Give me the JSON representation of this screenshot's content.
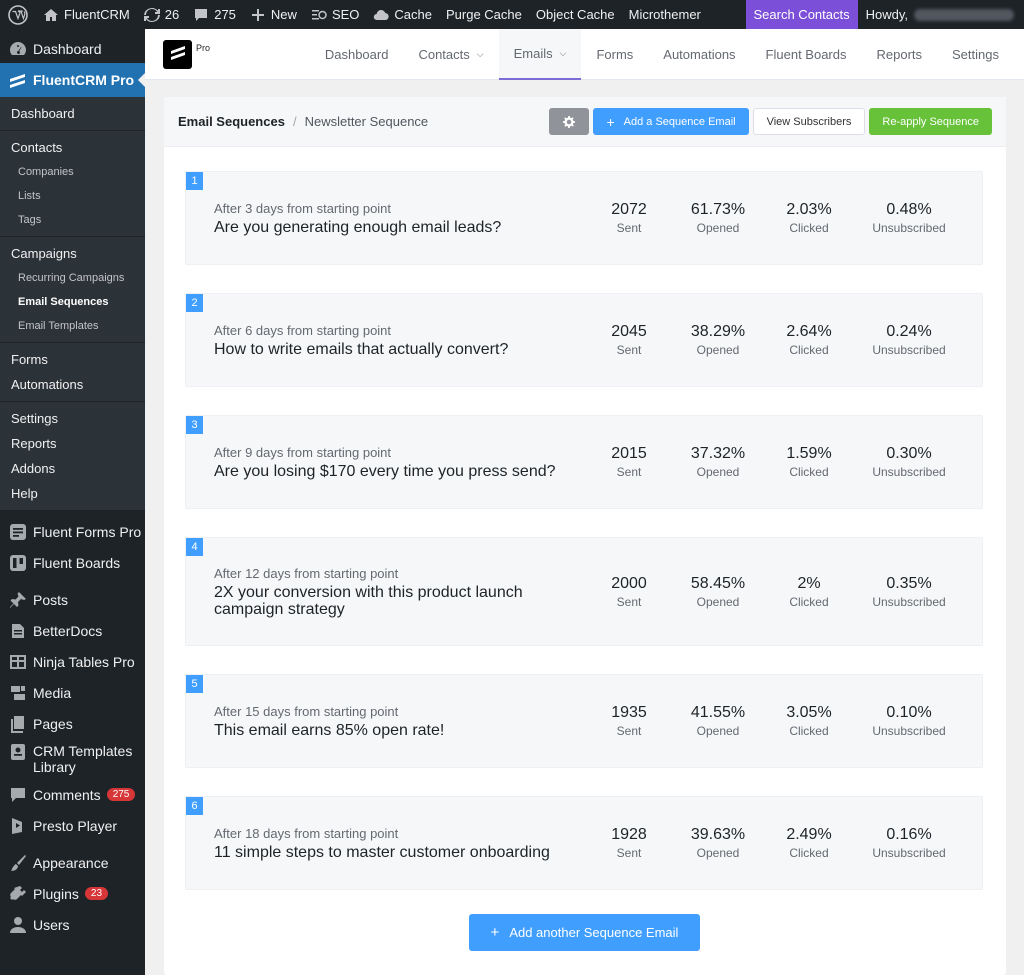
{
  "adminbar": {
    "site_name": "FluentCRM",
    "updates_count": "26",
    "comments_count": "275",
    "new_label": "New",
    "seo_label": "SEO",
    "cache_label": "Cache",
    "purge_cache_label": "Purge Cache",
    "object_cache_label": "Object Cache",
    "microthemer_label": "Microthemer",
    "search_contacts_label": "Search Contacts",
    "howdy_label": "Howdy,"
  },
  "sidebar": {
    "dashboard": "Dashboard",
    "fluentcrm_pro": "FluentCRM Pro",
    "sub": {
      "dashboard": "Dashboard",
      "contacts": "Contacts",
      "companies": "Companies",
      "lists": "Lists",
      "tags": "Tags",
      "campaigns": "Campaigns",
      "recurring": "Recurring Campaigns",
      "sequences": "Email Sequences",
      "templates": "Email Templates",
      "forms": "Forms",
      "automations": "Automations",
      "settings": "Settings",
      "reports": "Reports",
      "addons": "Addons",
      "help": "Help"
    },
    "fluent_forms": "Fluent Forms Pro",
    "fluent_boards": "Fluent Boards",
    "posts": "Posts",
    "betterdocs": "BetterDocs",
    "ninja_tables": "Ninja Tables Pro",
    "media": "Media",
    "pages": "Pages",
    "crm_templates_1": "CRM Templates",
    "crm_templates_2": "Library",
    "comments": "Comments",
    "comments_badge": "275",
    "presto": "Presto Player",
    "appearance": "Appearance",
    "plugins": "Plugins",
    "plugins_badge": "23",
    "users": "Users"
  },
  "topnav": {
    "logo_badge": "Pro",
    "links": [
      "Dashboard",
      "Contacts",
      "Emails",
      "Forms",
      "Automations",
      "Fluent Boards",
      "Reports",
      "Settings"
    ]
  },
  "header": {
    "breadcrumb_main": "Email Sequences",
    "breadcrumb_sep": "/",
    "breadcrumb_sub": "Newsletter Sequence",
    "add_email_label": "Add a Sequence Email",
    "view_subscribers_label": "View Subscribers",
    "reapply_label": "Re-apply Sequence"
  },
  "stat_labels": {
    "sent": "Sent",
    "opened": "Opened",
    "clicked": "Clicked",
    "unsubscribed": "Unsubscribed"
  },
  "sequences": [
    {
      "num": "1",
      "delay": "After 3 days from starting point",
      "title": "Are you generating enough email leads?",
      "sent": "2072",
      "opened": "61.73%",
      "clicked": "2.03%",
      "unsub": "0.48%"
    },
    {
      "num": "2",
      "delay": "After 6 days from starting point",
      "title": "How to write emails that actually convert?",
      "sent": "2045",
      "opened": "38.29%",
      "clicked": "2.64%",
      "unsub": "0.24%"
    },
    {
      "num": "3",
      "delay": "After 9 days from starting point",
      "title": "Are you losing $170 every time you press send?",
      "sent": "2015",
      "opened": "37.32%",
      "clicked": "1.59%",
      "unsub": "0.30%"
    },
    {
      "num": "4",
      "delay": "After 12 days from starting point",
      "title": "2X your conversion with this product launch campaign strategy",
      "sent": "2000",
      "opened": "58.45%",
      "clicked": "2%",
      "unsub": "0.35%"
    },
    {
      "num": "5",
      "delay": "After 15 days from starting point",
      "title": "This email earns 85% open rate!",
      "sent": "1935",
      "opened": "41.55%",
      "clicked": "3.05%",
      "unsub": "0.10%"
    },
    {
      "num": "6",
      "delay": "After 18 days from starting point",
      "title": "11 simple steps to master customer onboarding",
      "sent": "1928",
      "opened": "39.63%",
      "clicked": "2.49%",
      "unsub": "0.16%"
    }
  ],
  "add_another_label": "Add another Sequence Email"
}
